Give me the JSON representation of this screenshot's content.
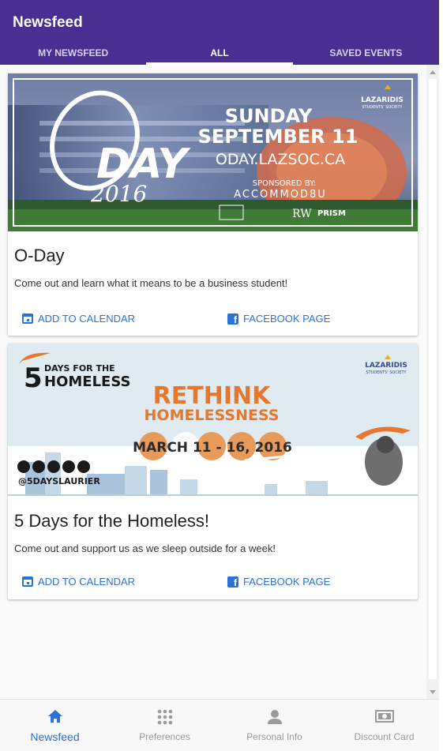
{
  "appbar": {
    "title": "Newsfeed"
  },
  "tabs": [
    {
      "label": "MY NEWSFEED"
    },
    {
      "label": "ALL"
    },
    {
      "label": "SAVED EVENTS"
    }
  ],
  "cards": [
    {
      "title": "O-Day",
      "description": "Come out and learn what it means to be a business student!",
      "action_calendar": "ADD TO CALENDAR",
      "action_facebook": "FACEBOOK PAGE",
      "banner": {
        "logo_o": "O",
        "logo_day": "DAY",
        "logo_year": "2016",
        "date_line1": "SUNDAY",
        "date_line2": "SEPTEMBER 11",
        "url": "ODAY.LAZSOC.CA",
        "sponsored_by": "SPONSORED BY:",
        "sponsor_main": "ACCOMMOD8U",
        "sponsor_rw": "RW",
        "sponsor_prism": "PRISM",
        "org_name": "LAZARIDIS",
        "org_sub": "STUDENTS' SOCIETY"
      }
    },
    {
      "title": "5 Days for the Homeless!",
      "description": "Come out and support us as we sleep outside for a week!",
      "action_calendar": "ADD TO CALENDAR",
      "action_facebook": "FACEBOOK PAGE",
      "banner": {
        "num": "5",
        "days_for_the": "DAYS FOR THE",
        "homeless": "HOMELESS",
        "rethink": "RETHINK",
        "homelessness": "HOMELESSNESS",
        "dates": "MARCH 11 - 16, 2016",
        "handle": "@5DAYSLAURIER",
        "org_name": "LAZARIDIS",
        "org_sub": "STUDENTS' SOCIETY"
      }
    }
  ],
  "bottomnav": [
    {
      "label": "Newsfeed",
      "icon": "home-icon"
    },
    {
      "label": "Preferences",
      "icon": "grid-icon"
    },
    {
      "label": "Personal Info",
      "icon": "person-icon"
    },
    {
      "label": "Discount Card",
      "icon": "money-card-icon"
    }
  ],
  "colors": {
    "appbar": "#4a2e91",
    "accent": "#2a72d6",
    "orange": "#e8772e"
  }
}
